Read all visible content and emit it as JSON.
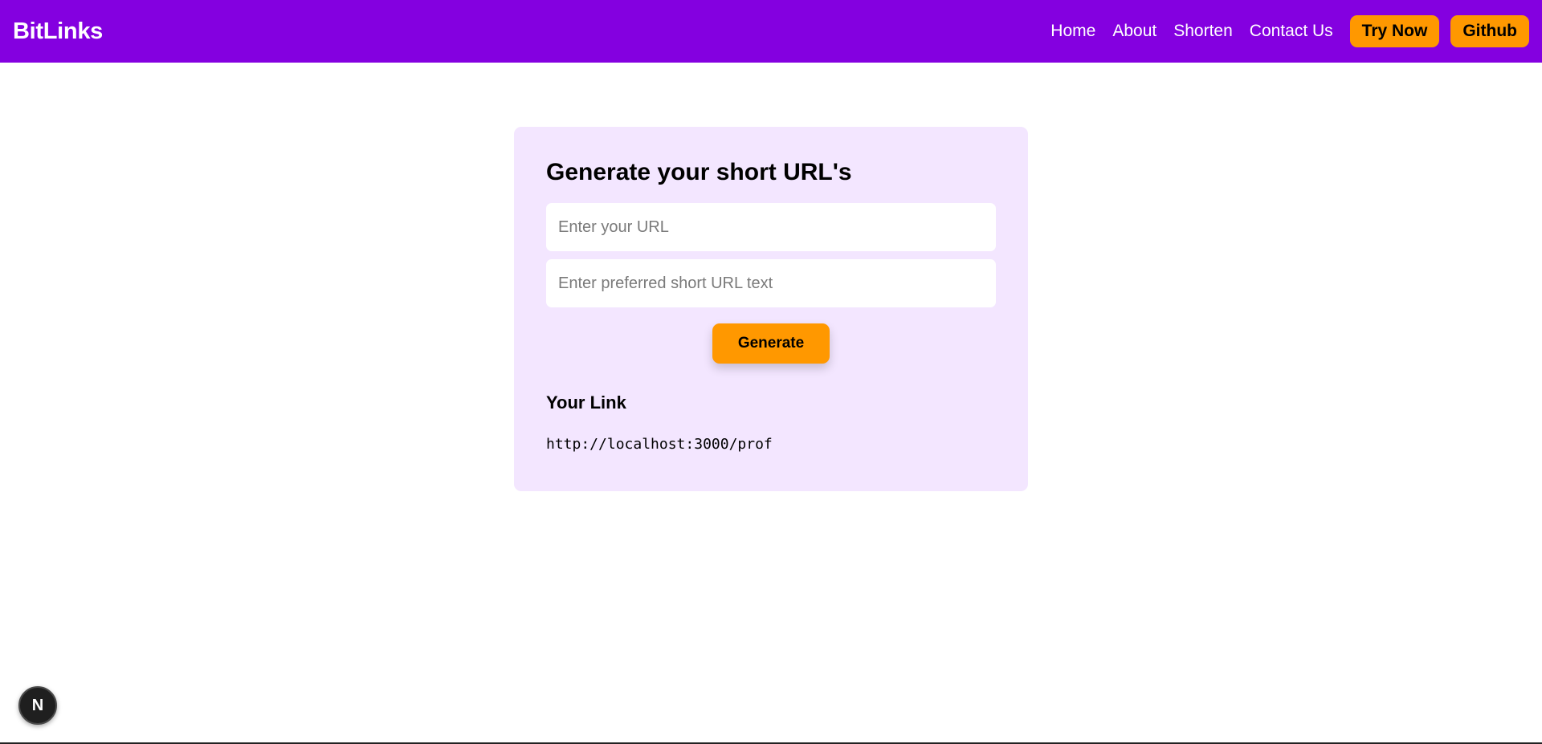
{
  "navbar": {
    "logo": "BitLinks",
    "links": [
      "Home",
      "About",
      "Shorten",
      "Contact Us"
    ],
    "try_now": "Try Now",
    "github": "Github",
    "background_color": "#8400e0",
    "button_color": "#ff9800"
  },
  "card": {
    "title": "Generate your short URL's",
    "url_input": {
      "placeholder": "Enter your URL",
      "value": ""
    },
    "short_input": {
      "placeholder": "Enter preferred short URL text",
      "value": ""
    },
    "generate_label": "Generate",
    "result_heading": "Your Link",
    "result_url": "http://localhost:3000/prof",
    "background_color": "#f3e6ff"
  },
  "dev_badge": {
    "letter": "N",
    "icon": "nextjs-icon"
  }
}
